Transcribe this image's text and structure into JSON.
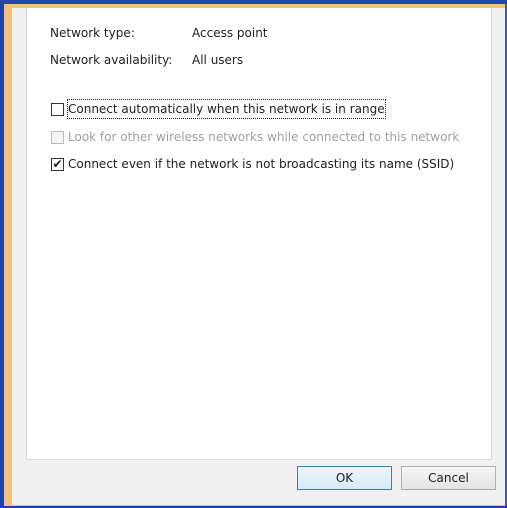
{
  "details": {
    "network_type_label": "Network type:",
    "network_type_value": "Access point",
    "availability_label": "Network availability:",
    "availability_value": "All users"
  },
  "options": [
    {
      "label": "Connect automatically when this network is in range",
      "checked": false,
      "enabled": true
    },
    {
      "label": "Look for other wireless networks while connected to this network",
      "checked": false,
      "enabled": false
    },
    {
      "label": "Connect even if the network is not broadcasting its name (SSID)",
      "checked": true,
      "enabled": true
    }
  ],
  "buttons": {
    "ok": "OK",
    "cancel": "Cancel"
  },
  "icons": {
    "checkmark": "✔"
  }
}
